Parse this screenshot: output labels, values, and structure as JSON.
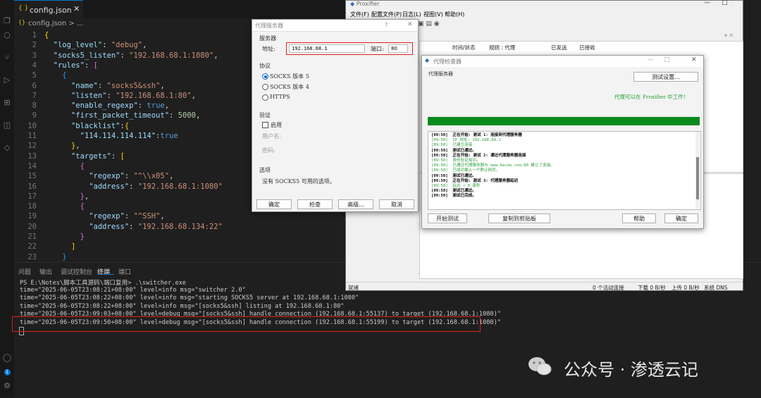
{
  "vscode": {
    "tab_label": "config.json",
    "breadcrumb": "config.json > ...",
    "code_lines": [
      {
        "n": "1",
        "html": "<span class='p'>{</span>"
      },
      {
        "n": "2",
        "html": "  <span class='k'>\"log_level\"</span>: <span class='s'>\"debug\"</span>,"
      },
      {
        "n": "3",
        "html": "  <span class='k'>\"socks5_listen\"</span>: <span class='s'>\"192.168.68.1:1080\"</span>,"
      },
      {
        "n": "4",
        "html": "  <span class='k'>\"rules\"</span>: <span class='p2'>[</span>"
      },
      {
        "n": "5",
        "html": "    <span class='p3'>{</span>"
      },
      {
        "n": "6",
        "html": "      <span class='k'>\"name\"</span>: <span class='s'>\"socks5&ssh\"</span>,"
      },
      {
        "n": "7",
        "html": "      <span class='k'>\"listen\"</span>: <span class='s'>\"192.168.68.1:80\"</span>,"
      },
      {
        "n": "8",
        "html": "      <span class='k'>\"enable_regexp\"</span>: <span class='b'>true</span>,"
      },
      {
        "n": "9",
        "html": "      <span class='k'>\"first_packet_timeout\"</span>: <span class='n'>5000</span>,"
      },
      {
        "n": "10",
        "html": "      <span class='k'>\"blacklist\"</span>:<span class='p'>{</span>"
      },
      {
        "n": "11",
        "html": "        <span class='k'>\"114.114.114.114\"</span>:<span class='b'>true</span>"
      },
      {
        "n": "12",
        "html": "      <span class='p'>}</span>,"
      },
      {
        "n": "13",
        "html": "      <span class='k'>\"targets\"</span>: <span class='p'>[</span>"
      },
      {
        "n": "14",
        "html": "        <span class='p2'>{</span>"
      },
      {
        "n": "15",
        "html": "          <span class='k'>\"regexp\"</span>: <span class='s'>\"^\\\\x05\"</span>,"
      },
      {
        "n": "16",
        "html": "          <span class='k'>\"address\"</span>: <span class='s'>\"192.168.68.1:1080\"</span>"
      },
      {
        "n": "17",
        "html": "        <span class='p2'>}</span>,"
      },
      {
        "n": "18",
        "html": "        <span class='p2'>{</span>"
      },
      {
        "n": "19",
        "html": "          <span class='k'>\"regexp\"</span>: <span class='s'>\"^SSH\"</span>,"
      },
      {
        "n": "20",
        "html": "          <span class='k'>\"address\"</span>: <span class='s'>\"192.168.68.134:22\"</span>"
      },
      {
        "n": "21",
        "html": "        <span class='p2'>}</span>"
      },
      {
        "n": "22",
        "html": "      <span class='p'>]</span>"
      },
      {
        "n": "23",
        "html": "    <span class='p3'>}</span>"
      }
    ],
    "panel_tabs": [
      "问题",
      "输出",
      "调试控制台",
      "终端",
      "端口"
    ],
    "terminal_lines": [
      "PS E:\\Notes\\脚本工具源码\\端口复用> .\\switcher.exe",
      "time=\"2025-06-05T23:08:21+08:00\" level=info msg=\"switcher 2.0\"",
      "time=\"2025-06-05T23:08:22+08:00\" level=info msg=\"starting SOCKS5 server at 192.168.68.1:1080\"",
      "time=\"2025-06-05T23:08:22+08:00\" level=info msg=\"[socks5&ssh] listing at 192.168.68.1:80\"",
      "time=\"2025-06-05T23:09:03+08:00\" level=debug msg=\"[socks5&ssh] handle connection (192.168.68.1:55137) to target (192.168.68.1:1080)\"",
      "time=\"2025-06-05T23:09:50+08:00\" level=debug msg=\"[socks5&ssh] handle connection (192.168.68.1:55199) to target (192.168.68.1:1080)\""
    ]
  },
  "proxifier": {
    "title": "Proxifier",
    "menu": [
      "文件(F)",
      "配置文件(P)",
      "日志(L)",
      "视图(V)",
      "帮助(H)"
    ],
    "columns": [
      "时间/状态",
      "规则 : 代理",
      "已发送",
      "已接收"
    ],
    "status_left": "就绪",
    "status_items": [
      "0 个活动连接",
      "下载 0 B/秒",
      "上传 0 B/秒",
      "系统 DNS"
    ]
  },
  "proxy_server_dialog": {
    "title": "代理服务器",
    "help": "?",
    "group_server": "服务器",
    "address_label": "地址:",
    "address_value": "192.168.68.1",
    "port_label": "端口:",
    "port_value": "80",
    "group_protocol": "协议",
    "protocols": [
      "SOCKS 版本 5",
      "SOCKS 版本 4",
      "HTTPS"
    ],
    "group_auth": "验证",
    "enable_label": "启用",
    "username_label": "用户名:",
    "password_label": "密码:",
    "group_options": "选项",
    "options_text": "没有 SOCKS5 可用的选项。",
    "buttons": [
      "确定",
      "检查",
      "高级...",
      "取消"
    ]
  },
  "checker_dialog": {
    "title": "代理检查器",
    "proxy_label": "代理服务器",
    "settings_button": "测试设置...",
    "success_msg": "代理可以在 Proxifier 中工作！",
    "progress": 1.0,
    "log_lines": [
      {
        "c": "lb",
        "t": "[09:50]  正在开始: 测试 1: 连接到代理服务器"
      },
      {
        "c": "lg",
        "t": "[09:50]  IP 地址: 192.168.68.1"
      },
      {
        "c": "lg",
        "t": "[09:50]  已建立连接"
      },
      {
        "c": "lb",
        "t": "[09:50]  测试已通过。"
      },
      {
        "c": "lb",
        "t": "[09:50]  正在开始: 测试 2: 通过代理服务器连接"
      },
      {
        "c": "lg",
        "t": "[09:50]  身份验证成功。"
      },
      {
        "c": "lg",
        "t": "[09:50]  已通过代理服务器与 www.baidu.com:80 建立了连接。"
      },
      {
        "c": "lg",
        "t": "[09:50]  已成功载入一个默认网页。"
      },
      {
        "c": "lb",
        "t": "[09:50]  测试已通过。"
      },
      {
        "c": "lb",
        "t": "[09:50]  正在开始: 测试 3: 代理服务器延迟"
      },
      {
        "c": "lg",
        "t": "[09:50]  延迟 < 0 毫秒"
      },
      {
        "c": "lb",
        "t": "[09:50]  测试已通过。"
      },
      {
        "c": "lb",
        "t": "[09:50]  测试已完成。"
      }
    ],
    "buttons": [
      "开始测试",
      "复制到剪贴板",
      "帮助",
      "确定"
    ]
  },
  "watermark": "公众号 · 渗透云记",
  "colors": {
    "vscode_bg": "#1f1f1f",
    "progress": "#0a8a1e",
    "highlight": "#e02020"
  }
}
